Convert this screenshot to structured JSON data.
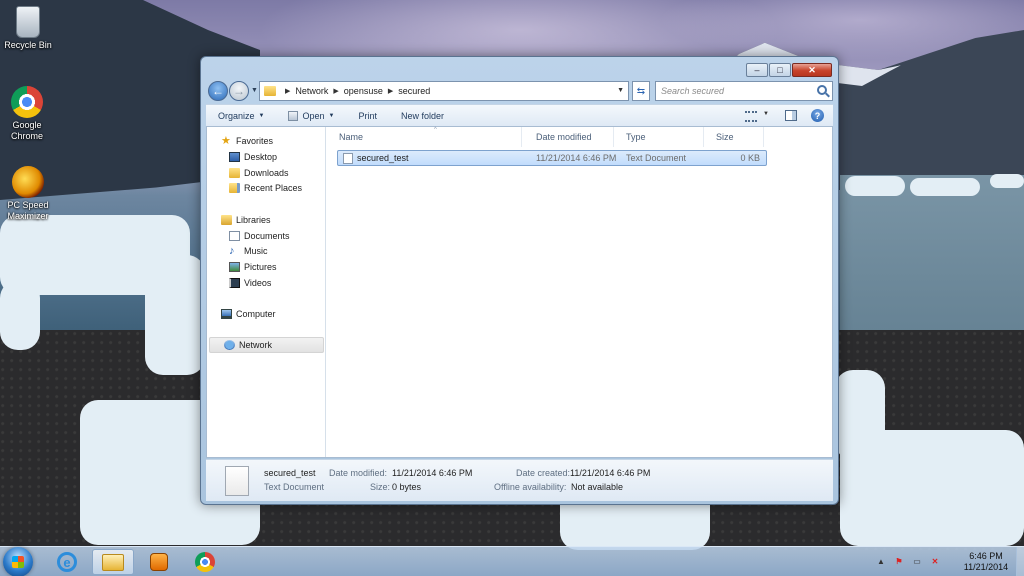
{
  "desktop": {
    "icons": [
      {
        "label": "Recycle Bin",
        "icon": "recycle-bin-icon"
      },
      {
        "label": "Google Chrome",
        "icon": "chrome-icon"
      },
      {
        "label": "PC Speed Maximizer",
        "icon": "pc-speed-maximizer-icon"
      }
    ]
  },
  "window": {
    "controls": {
      "minimize": "–",
      "maximize": "□",
      "close": "✕"
    },
    "address": {
      "crumbs": [
        "Network",
        "opensuse",
        "secured"
      ],
      "search_placeholder": "Search secured"
    },
    "toolbar": {
      "organize": "Organize",
      "open": "Open",
      "print": "Print",
      "new_folder": "New folder"
    },
    "nav_pane": {
      "favorites": "Favorites",
      "favorites_items": [
        "Desktop",
        "Downloads",
        "Recent Places"
      ],
      "libraries": "Libraries",
      "libraries_items": [
        "Documents",
        "Music",
        "Pictures",
        "Videos"
      ],
      "computer": "Computer",
      "network": "Network"
    },
    "columns": [
      "Name",
      "Date modified",
      "Type",
      "Size"
    ],
    "files": [
      {
        "name": "secured_test",
        "date_modified": "11/21/2014 6:46 PM",
        "type": "Text Document",
        "size": "0 KB",
        "selected": true
      }
    ],
    "details_pane": {
      "name": "secured_test",
      "type": "Text Document",
      "date_modified_label": "Date modified:",
      "date_modified": "11/21/2014 6:46 PM",
      "size_label": "Size:",
      "size": "0 bytes",
      "date_created_label": "Date created:",
      "date_created": "11/21/2014 6:46 PM",
      "offline_label": "Offline availability:",
      "offline": "Not available"
    }
  },
  "taskbar": {
    "apps": [
      "internet-explorer-icon",
      "windows-explorer-icon",
      "media-player-icon",
      "chrome-icon"
    ],
    "clock": {
      "time": "6:46 PM",
      "date": "11/21/2014"
    }
  }
}
